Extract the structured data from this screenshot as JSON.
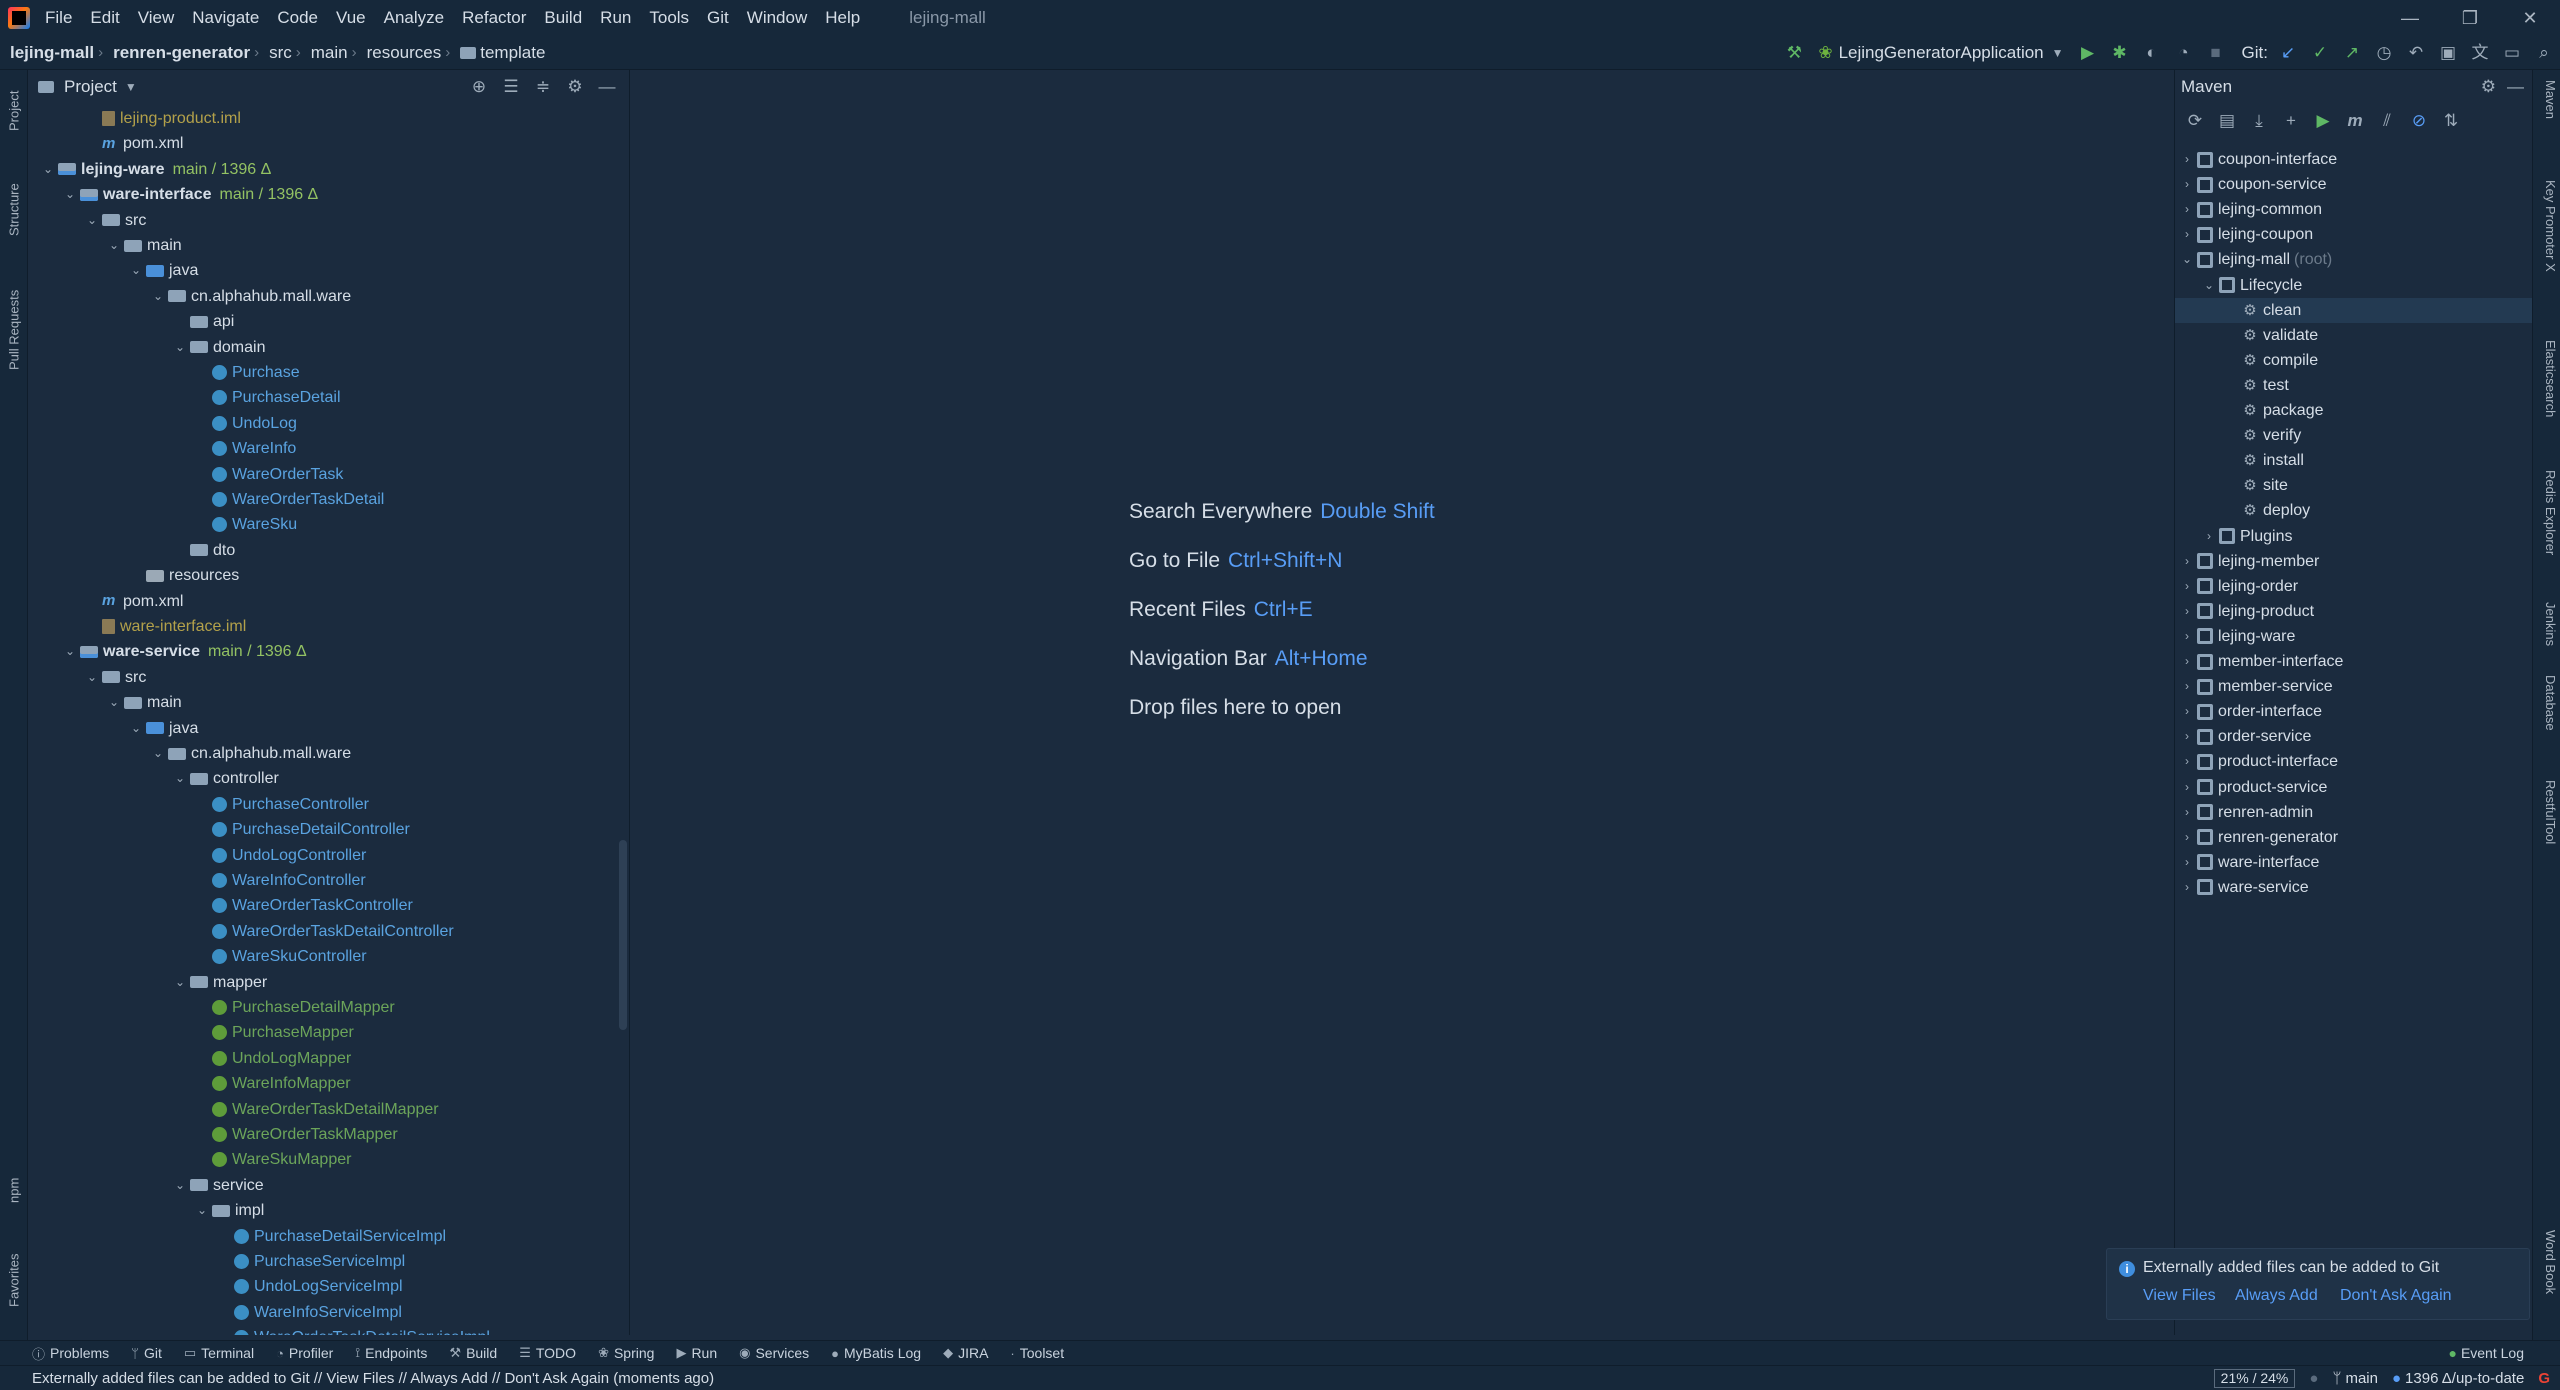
{
  "menu": [
    "File",
    "Edit",
    "View",
    "Navigate",
    "Code",
    "Vue",
    "Analyze",
    "Refactor",
    "Build",
    "Run",
    "Tools",
    "Git",
    "Window",
    "Help"
  ],
  "window_title": "lejing-mall",
  "breadcrumb": [
    "lejing-mall",
    "renren-generator",
    "src",
    "main",
    "resources",
    "template"
  ],
  "run_config": "LejingGeneratorApplication",
  "git_label": "Git:",
  "project_panel": {
    "title": "Project"
  },
  "tree": [
    {
      "label": "lejing-product.iml",
      "level": 3,
      "icon": "iml",
      "color": "olive",
      "arrow": ""
    },
    {
      "label": "pom.xml",
      "level": 3,
      "icon": "m",
      "color": "",
      "arrow": ""
    },
    {
      "label": "lejing-ware",
      "level": 1,
      "icon": "module",
      "color": "",
      "bold": true,
      "arrow": "open",
      "git": "main / 1396 Δ"
    },
    {
      "label": "ware-interface",
      "level": 2,
      "icon": "module",
      "color": "",
      "bold": true,
      "arrow": "open",
      "git": "main / 1396 Δ"
    },
    {
      "label": "src",
      "level": 3,
      "icon": "folder",
      "color": "",
      "arrow": "open"
    },
    {
      "label": "main",
      "level": 4,
      "icon": "folder",
      "color": "",
      "arrow": "open"
    },
    {
      "label": "java",
      "level": 5,
      "icon": "src",
      "color": "",
      "arrow": "open"
    },
    {
      "label": "cn.alphahub.mall.ware",
      "level": 6,
      "icon": "folder",
      "color": "",
      "arrow": "open"
    },
    {
      "label": "api",
      "level": 7,
      "icon": "folder",
      "color": "",
      "arrow": ""
    },
    {
      "label": "domain",
      "level": 7,
      "icon": "folder",
      "color": "",
      "arrow": "open"
    },
    {
      "label": "Purchase",
      "level": 8,
      "icon": "cls",
      "color": "blue",
      "arrow": ""
    },
    {
      "label": "PurchaseDetail",
      "level": 8,
      "icon": "cls",
      "color": "blue",
      "arrow": ""
    },
    {
      "label": "UndoLog",
      "level": 8,
      "icon": "cls",
      "color": "blue",
      "arrow": ""
    },
    {
      "label": "WareInfo",
      "level": 8,
      "icon": "cls",
      "color": "blue",
      "arrow": ""
    },
    {
      "label": "WareOrderTask",
      "level": 8,
      "icon": "cls",
      "color": "blue",
      "arrow": ""
    },
    {
      "label": "WareOrderTaskDetail",
      "level": 8,
      "icon": "cls",
      "color": "blue",
      "arrow": ""
    },
    {
      "label": "WareSku",
      "level": 8,
      "icon": "cls",
      "color": "blue",
      "arrow": ""
    },
    {
      "label": "dto",
      "level": 7,
      "icon": "folder",
      "color": "",
      "arrow": ""
    },
    {
      "label": "resources",
      "level": 5,
      "icon": "res",
      "color": "",
      "arrow": ""
    },
    {
      "label": "pom.xml",
      "level": 3,
      "icon": "m",
      "color": "",
      "arrow": ""
    },
    {
      "label": "ware-interface.iml",
      "level": 3,
      "icon": "iml",
      "color": "olive",
      "arrow": ""
    },
    {
      "label": "ware-service",
      "level": 2,
      "icon": "module",
      "color": "",
      "bold": true,
      "arrow": "open",
      "git": "main / 1396 Δ"
    },
    {
      "label": "src",
      "level": 3,
      "icon": "folder",
      "color": "",
      "arrow": "open"
    },
    {
      "label": "main",
      "level": 4,
      "icon": "folder",
      "color": "",
      "arrow": "open"
    },
    {
      "label": "java",
      "level": 5,
      "icon": "src",
      "color": "",
      "arrow": "open"
    },
    {
      "label": "cn.alphahub.mall.ware",
      "level": 6,
      "icon": "folder",
      "color": "",
      "arrow": "open"
    },
    {
      "label": "controller",
      "level": 7,
      "icon": "folder",
      "color": "",
      "arrow": "open"
    },
    {
      "label": "PurchaseController",
      "level": 8,
      "icon": "cls",
      "color": "blue",
      "arrow": ""
    },
    {
      "label": "PurchaseDetailController",
      "level": 8,
      "icon": "cls",
      "color": "blue",
      "arrow": ""
    },
    {
      "label": "UndoLogController",
      "level": 8,
      "icon": "cls",
      "color": "blue",
      "arrow": ""
    },
    {
      "label": "WareInfoController",
      "level": 8,
      "icon": "cls",
      "color": "blue",
      "arrow": ""
    },
    {
      "label": "WareOrderTaskController",
      "level": 8,
      "icon": "cls",
      "color": "blue",
      "arrow": ""
    },
    {
      "label": "WareOrderTaskDetailController",
      "level": 8,
      "icon": "cls",
      "color": "blue",
      "arrow": ""
    },
    {
      "label": "WareSkuController",
      "level": 8,
      "icon": "cls",
      "color": "blue",
      "arrow": ""
    },
    {
      "label": "mapper",
      "level": 7,
      "icon": "folder",
      "color": "",
      "arrow": "open"
    },
    {
      "label": "PurchaseDetailMapper",
      "level": 8,
      "icon": "intf",
      "color": "green",
      "arrow": ""
    },
    {
      "label": "PurchaseMapper",
      "level": 8,
      "icon": "intf",
      "color": "green",
      "arrow": ""
    },
    {
      "label": "UndoLogMapper",
      "level": 8,
      "icon": "intf",
      "color": "green",
      "arrow": ""
    },
    {
      "label": "WareInfoMapper",
      "level": 8,
      "icon": "intf",
      "color": "green",
      "arrow": ""
    },
    {
      "label": "WareOrderTaskDetailMapper",
      "level": 8,
      "icon": "intf",
      "color": "green",
      "arrow": ""
    },
    {
      "label": "WareOrderTaskMapper",
      "level": 8,
      "icon": "intf",
      "color": "green",
      "arrow": ""
    },
    {
      "label": "WareSkuMapper",
      "level": 8,
      "icon": "intf",
      "color": "green",
      "arrow": ""
    },
    {
      "label": "service",
      "level": 7,
      "icon": "folder",
      "color": "",
      "arrow": "open"
    },
    {
      "label": "impl",
      "level": 8,
      "icon": "folder",
      "color": "",
      "arrow": "open"
    },
    {
      "label": "PurchaseDetailServiceImpl",
      "level": 9,
      "icon": "cls",
      "color": "blue",
      "arrow": ""
    },
    {
      "label": "PurchaseServiceImpl",
      "level": 9,
      "icon": "cls",
      "color": "blue",
      "arrow": ""
    },
    {
      "label": "UndoLogServiceImpl",
      "level": 9,
      "icon": "cls",
      "color": "blue",
      "arrow": ""
    },
    {
      "label": "WareInfoServiceImpl",
      "level": 9,
      "icon": "cls",
      "color": "blue",
      "arrow": ""
    },
    {
      "label": "WareOrderTaskDetailServiceImpl",
      "level": 9,
      "icon": "cls",
      "color": "blue",
      "arrow": ""
    }
  ],
  "editor_hints": [
    {
      "text": "Search Everywhere",
      "key": "Double Shift"
    },
    {
      "text": "Go to File",
      "key": "Ctrl+Shift+N"
    },
    {
      "text": "Recent Files",
      "key": "Ctrl+E"
    },
    {
      "text": "Navigation Bar",
      "key": "Alt+Home"
    },
    {
      "text": "Drop files here to open",
      "key": ""
    }
  ],
  "maven": {
    "title": "Maven",
    "items": [
      {
        "label": "coupon-interface",
        "level": 0,
        "type": "project",
        "arrow": "closed"
      },
      {
        "label": "coupon-service",
        "level": 0,
        "type": "project",
        "arrow": "closed"
      },
      {
        "label": "lejing-common",
        "level": 0,
        "type": "project",
        "arrow": "closed"
      },
      {
        "label": "lejing-coupon",
        "level": 0,
        "type": "project",
        "arrow": "closed"
      },
      {
        "label": "lejing-mall",
        "level": 0,
        "type": "project",
        "arrow": "open",
        "suffix": "(root)"
      },
      {
        "label": "Lifecycle",
        "level": 1,
        "type": "folder",
        "arrow": "open"
      },
      {
        "label": "clean",
        "level": 2,
        "type": "goal",
        "arrow": "",
        "selected": true
      },
      {
        "label": "validate",
        "level": 2,
        "type": "goal",
        "arrow": ""
      },
      {
        "label": "compile",
        "level": 2,
        "type": "goal",
        "arrow": ""
      },
      {
        "label": "test",
        "level": 2,
        "type": "goal",
        "arrow": ""
      },
      {
        "label": "package",
        "level": 2,
        "type": "goal",
        "arrow": ""
      },
      {
        "label": "verify",
        "level": 2,
        "type": "goal",
        "arrow": ""
      },
      {
        "label": "install",
        "level": 2,
        "type": "goal",
        "arrow": ""
      },
      {
        "label": "site",
        "level": 2,
        "type": "goal",
        "arrow": ""
      },
      {
        "label": "deploy",
        "level": 2,
        "type": "goal",
        "arrow": ""
      },
      {
        "label": "Plugins",
        "level": 1,
        "type": "folder",
        "arrow": "closed"
      },
      {
        "label": "lejing-member",
        "level": 0,
        "type": "project",
        "arrow": "closed"
      },
      {
        "label": "lejing-order",
        "level": 0,
        "type": "project",
        "arrow": "closed"
      },
      {
        "label": "lejing-product",
        "level": 0,
        "type": "project",
        "arrow": "closed"
      },
      {
        "label": "lejing-ware",
        "level": 0,
        "type": "project",
        "arrow": "closed"
      },
      {
        "label": "member-interface",
        "level": 0,
        "type": "project",
        "arrow": "closed"
      },
      {
        "label": "member-service",
        "level": 0,
        "type": "project",
        "arrow": "closed"
      },
      {
        "label": "order-interface",
        "level": 0,
        "type": "project",
        "arrow": "closed"
      },
      {
        "label": "order-service",
        "level": 0,
        "type": "project",
        "arrow": "closed"
      },
      {
        "label": "product-interface",
        "level": 0,
        "type": "project",
        "arrow": "closed"
      },
      {
        "label": "product-service",
        "level": 0,
        "type": "project",
        "arrow": "closed"
      },
      {
        "label": "renren-admin",
        "level": 0,
        "type": "project",
        "arrow": "closed"
      },
      {
        "label": "renren-generator",
        "level": 0,
        "type": "project",
        "arrow": "closed"
      },
      {
        "label": "ware-interface",
        "level": 0,
        "type": "project",
        "arrow": "closed"
      },
      {
        "label": "ware-service",
        "level": 0,
        "type": "project",
        "arrow": "closed"
      }
    ]
  },
  "left_tabs": [
    "Project",
    "Structure",
    "Pull Requests",
    "npm",
    "Favorites"
  ],
  "right_tabs": [
    "Maven",
    "Key Promoter X",
    "Elasticsearch",
    "Redis Explorer",
    "Jenkins",
    "Database",
    "RestfulTool",
    "Word Book"
  ],
  "notification": {
    "text": "Externally added files can be added to Git",
    "links": [
      "View Files",
      "Always Add",
      "Don't Ask Again"
    ]
  },
  "bottom_tools": [
    "Problems",
    "Git",
    "Terminal",
    "Profiler",
    "Endpoints",
    "Build",
    "TODO",
    "Spring",
    "Run",
    "Services",
    "MyBatis Log",
    "JIRA",
    "Toolset"
  ],
  "event_log": "Event Log",
  "status": {
    "message": "Externally added files can be added to Git // View Files // Always Add // Don't Ask Again (moments ago)",
    "memory": "21% / 24%",
    "branch": "main",
    "vcs": "1396 Δ/up-to-date"
  },
  "colors": {
    "background": "#1b2b3e",
    "chrome": "#16283a",
    "accent": "#589df6"
  }
}
